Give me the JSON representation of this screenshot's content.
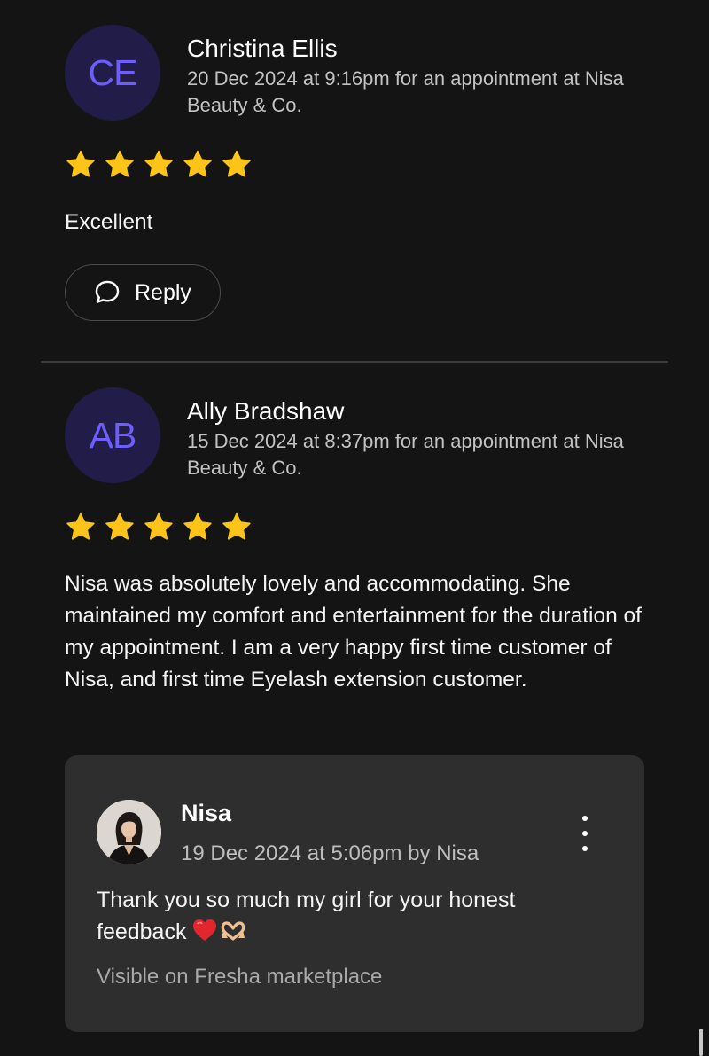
{
  "reviews": [
    {
      "initials": "CE",
      "name": "Christina Ellis",
      "meta": "20 Dec 2024 at 9:16pm for an appointment at Nisa Beauty & Co.",
      "rating": 5,
      "text": "Excellent",
      "reply_label": "Reply"
    },
    {
      "initials": "AB",
      "name": "Ally Bradshaw",
      "meta": "15 Dec 2024 at 8:37pm for an appointment at Nisa Beauty & Co.",
      "rating": 5,
      "text": "Nisa was absolutely lovely and accommodating. She maintained my comfort and entertainment for the duration of my appointment.  I am a very happy first time customer of Nisa, and first time Eyelash extension customer."
    }
  ],
  "owner_reply": {
    "name": "Nisa",
    "meta": "19 Dec 2024 at 5:06pm by Nisa",
    "text": "Thank you so much my girl for your honest feedback",
    "emojis": [
      "red-heart-emoji",
      "heart-hands-emoji"
    ],
    "visibility": "Visible on Fresha marketplace",
    "menu_icon": "more-vertical-icon"
  },
  "colors": {
    "background": "#141414",
    "avatar_bg": "#211d48",
    "avatar_text": "#6d5dfc",
    "star": "#fcc419",
    "card_bg": "#2e2e2e"
  }
}
